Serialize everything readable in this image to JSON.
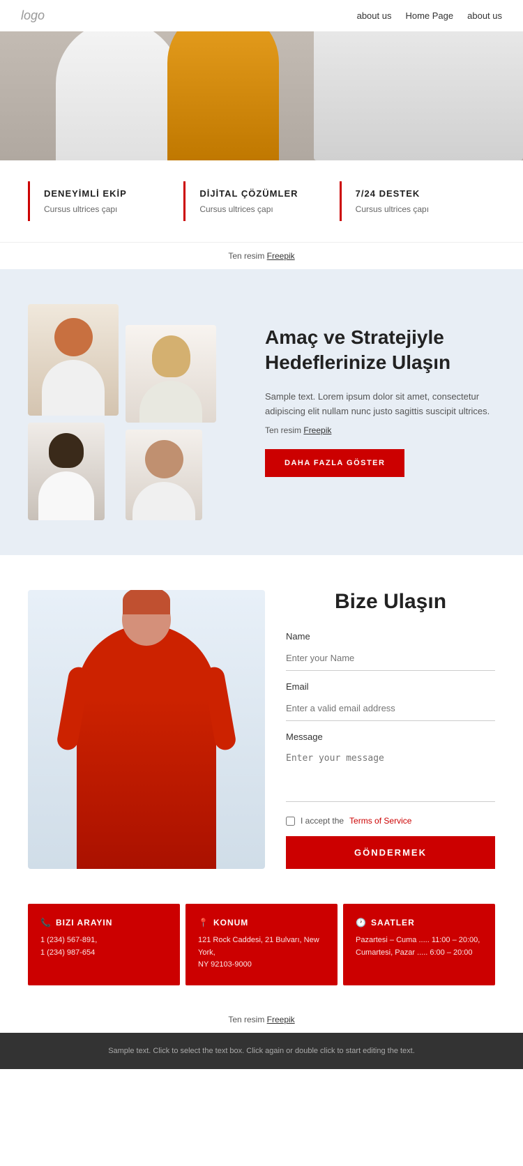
{
  "header": {
    "logo": "logo",
    "nav": [
      {
        "label": "about us",
        "href": "#"
      },
      {
        "label": "Home Page",
        "href": "#"
      },
      {
        "label": "about us",
        "href": "#"
      }
    ]
  },
  "features": [
    {
      "title": "DENEYİMLİ EKİP",
      "desc": "Cursus ultrices çapı"
    },
    {
      "title": "DİJİTAL ÇÖZÜMLER",
      "desc": "Cursus ultrices çapı"
    },
    {
      "title": "7/24 DESTEK",
      "desc": "Cursus ultrices çapı"
    }
  ],
  "freepik1": {
    "text": "Ten resim ",
    "link": "Freepik"
  },
  "team": {
    "title": "Amaç ve Stratejiyle Hedeflerinize Ulaşın",
    "text": "Sample text. Lorem ipsum dolor sit amet, consectetur adipiscing elit nullam nunc justo sagittis suscipit ultrices.",
    "credit_text": "Ten resim ",
    "credit_link": "Freepik",
    "button": "DAHA FAZLA GÖSTER"
  },
  "contact": {
    "title": "Bize Ulaşın",
    "name_label": "Name",
    "name_placeholder": "Enter your Name",
    "email_label": "Email",
    "email_placeholder": "Enter a valid email address",
    "message_label": "Message",
    "message_placeholder": "Enter your message",
    "terms_text": "I accept the ",
    "terms_link": "Terms of Service",
    "submit_button": "GÖNDERMEK"
  },
  "info_cards": [
    {
      "icon": "📞",
      "title": "BIZI ARAYIN",
      "lines": [
        "1 (234) 567-891,",
        "1 (234) 987-654"
      ]
    },
    {
      "icon": "📍",
      "title": "KONUM",
      "lines": [
        "121 Rock Caddesi, 21 Bulvarı, New York,",
        "NY 92103-9000"
      ]
    },
    {
      "icon": "🕐",
      "title": "SAATLER",
      "lines": [
        "Pazartesi – Cuma ..... 11:00 – 20:00,",
        "Cumartesi, Pazar ..... 6:00 – 20:00"
      ]
    }
  ],
  "freepik2": {
    "text": "Ten resim ",
    "link": "Freepik"
  },
  "footer": {
    "text": "Sample text. Click to select the text box. Click again or double click to start editing the text."
  }
}
